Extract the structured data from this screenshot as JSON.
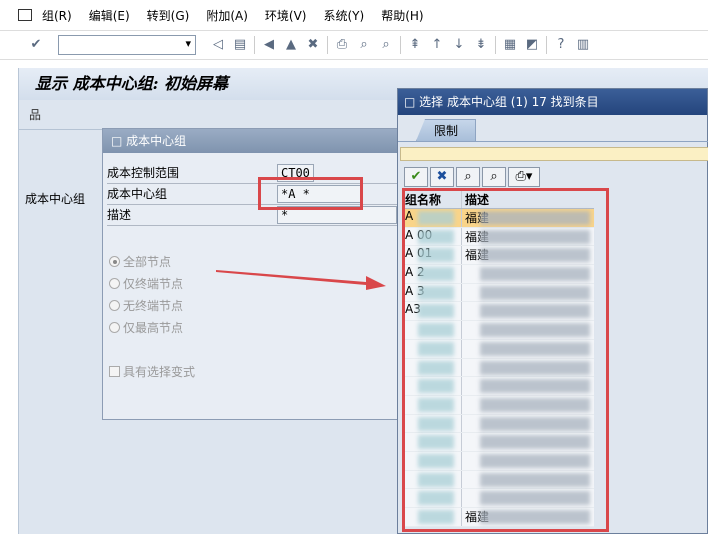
{
  "menu": [
    "组(R)",
    "编辑(E)",
    "转到(G)",
    "附加(A)",
    "环境(V)",
    "系统(Y)",
    "帮助(H)"
  ],
  "toolbar": {
    "command_field": ""
  },
  "screen": {
    "title": "显示 成本中心组: 初始屏幕",
    "left_label": "成本中心组"
  },
  "dialog": {
    "title": "成本中心组",
    "fields": [
      {
        "label": "成本控制范围",
        "value": "CT00"
      },
      {
        "label": "成本中心组",
        "value": "*A     *"
      },
      {
        "label": "描述",
        "value": "*"
      }
    ],
    "radios": [
      {
        "label": "全部节点",
        "selected": true
      },
      {
        "label": "仅终端节点",
        "selected": false
      },
      {
        "label": "无终端节点",
        "selected": false
      },
      {
        "label": "仅最高节点",
        "selected": false
      }
    ],
    "checkbox": {
      "label": "具有选择变式",
      "checked": false
    }
  },
  "popup": {
    "title": "选择 成本中心组 (1)  17 找到条目",
    "tab": "限制",
    "columns": [
      "组名称",
      "描述"
    ],
    "rows": [
      {
        "name": "A",
        "desc": "福建"
      },
      {
        "name": "A   00",
        "desc": "福建"
      },
      {
        "name": "A   01",
        "desc": "福建"
      },
      {
        "name": "A   2",
        "desc": ""
      },
      {
        "name": "A   3",
        "desc": ""
      },
      {
        "name": "A3",
        "desc": ""
      },
      {
        "name": "",
        "desc": ""
      },
      {
        "name": "",
        "desc": ""
      },
      {
        "name": "",
        "desc": ""
      },
      {
        "name": "",
        "desc": ""
      },
      {
        "name": "",
        "desc": ""
      },
      {
        "name": "",
        "desc": ""
      },
      {
        "name": "",
        "desc": ""
      },
      {
        "name": "",
        "desc": ""
      },
      {
        "name": "",
        "desc": ""
      },
      {
        "name": "",
        "desc": ""
      },
      {
        "name": "",
        "desc": "福建"
      }
    ]
  },
  "colors": {
    "highlight": "#d9474a",
    "popup_title": "#2a4d8a",
    "selected_row": "#f9d489"
  }
}
